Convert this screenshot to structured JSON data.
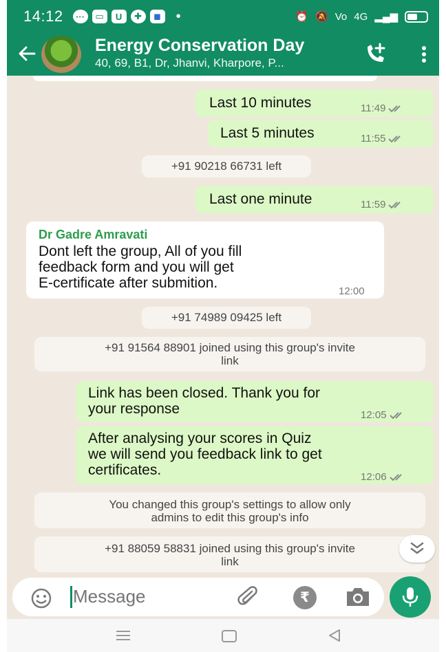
{
  "status_bar": {
    "time": "14:12",
    "network": "4G"
  },
  "header": {
    "title": "Energy Conservation Day",
    "subtitle": "40, 69, B1, Dr, Jhanvi, Kharpore, P...",
    "back_icon": "arrow-left-icon",
    "call_icon": "add-call-icon",
    "menu_icon": "more-vert-icon"
  },
  "messages": [
    {
      "text": "Last 10 minutes",
      "time": "11:49"
    },
    {
      "text": "Last 5 minutes",
      "time": "11:55"
    },
    {
      "system": "+91 90218 66731 left"
    },
    {
      "text": "Last one minute",
      "time": "11:59"
    },
    {
      "sender": "Dr Gadre Amravati",
      "text": "Dont left the group, All of you fill feedback form and you will get E-certificate after submition.",
      "lines": [
        "Dont left the group, All of you fill",
        "feedback form and you will get",
        "E-certificate after submition."
      ],
      "time": "12:00"
    },
    {
      "system": "+91 74989 09425 left"
    },
    {
      "system": "+91 91564 88901 joined using this group's invite link",
      "lines": [
        "+91 91564 88901 joined using this group's invite",
        "link"
      ]
    },
    {
      "text": "Link has been closed. Thank you for your response",
      "lines": [
        "Link has been closed. Thank you for",
        "your response"
      ],
      "time": "12:05"
    },
    {
      "text": "After analysing your scores in Quiz we will send you feedback link to get certificates.",
      "lines": [
        "After analysing your scores in Quiz",
        "we will send you feedback link to get",
        "certificates."
      ],
      "time": "12:06"
    },
    {
      "system": "You changed this group's settings to allow only admins to edit this group's info",
      "lines": [
        "You changed this group's settings to allow only",
        "admins to edit this group's info"
      ]
    },
    {
      "system": "+91 88059 58831 joined using this group's invite link",
      "lines": [
        "+91 88059 58831 joined using this group's invite",
        "link"
      ]
    }
  ],
  "input": {
    "placeholder": "Message"
  },
  "colors": {
    "header": "#128c62",
    "outgoing": "#dcf8c6",
    "incoming": "#ffffff",
    "chat_bg": "#efe7dd",
    "mic": "#1aa173",
    "ticks": "#8c8c8c"
  }
}
